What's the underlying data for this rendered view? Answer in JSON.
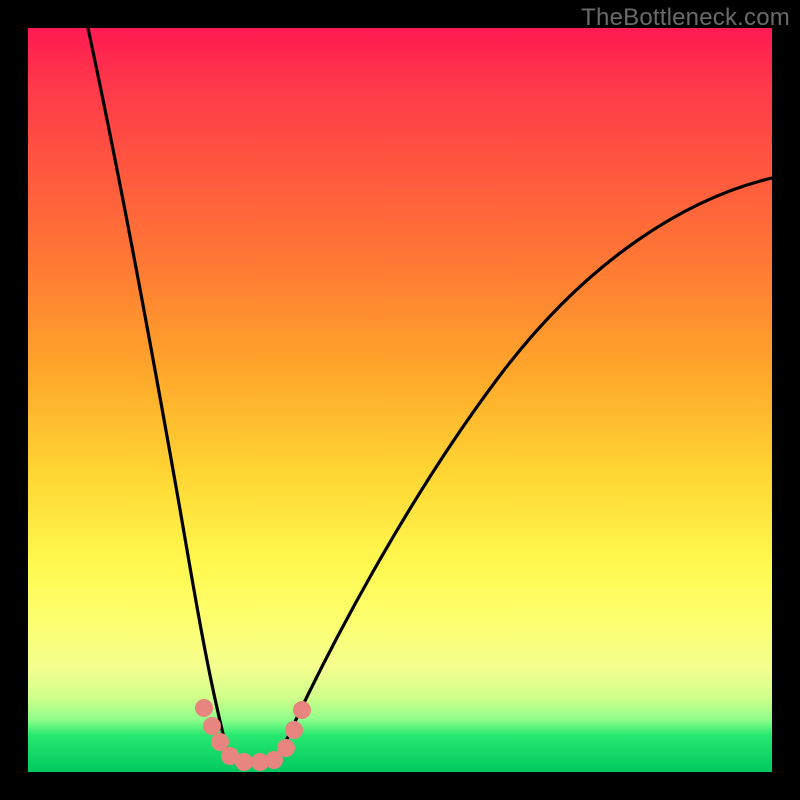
{
  "watermark": "TheBottleneck.com",
  "chart_data": {
    "type": "line",
    "title": "",
    "xlabel": "",
    "ylabel": "",
    "xlim": [
      0,
      100
    ],
    "ylim": [
      0,
      100
    ],
    "series": [
      {
        "name": "left-curve",
        "x": [
          8,
          10,
          12,
          14,
          16,
          18,
          20,
          22,
          24,
          25.5,
          27
        ],
        "y": [
          100,
          82,
          65,
          50,
          37,
          26,
          17,
          10,
          5,
          2,
          0
        ]
      },
      {
        "name": "right-curve",
        "x": [
          34,
          36,
          39,
          43,
          48,
          55,
          63,
          72,
          82,
          92,
          100
        ],
        "y": [
          0,
          4,
          11,
          21,
          33,
          45,
          56,
          65,
          72,
          77,
          80
        ]
      },
      {
        "name": "floor",
        "x": [
          27,
          34
        ],
        "y": [
          0,
          0
        ]
      }
    ],
    "markers": {
      "name": "highlight-points",
      "color": "#e8857f",
      "points": [
        {
          "x": 23.5,
          "y": 7.5
        },
        {
          "x": 24.5,
          "y": 5.0
        },
        {
          "x": 25.5,
          "y": 2.5
        },
        {
          "x": 27.0,
          "y": 1.0
        },
        {
          "x": 29.0,
          "y": 0.6
        },
        {
          "x": 31.0,
          "y": 0.6
        },
        {
          "x": 33.0,
          "y": 0.8
        },
        {
          "x": 34.5,
          "y": 2.5
        },
        {
          "x": 35.7,
          "y": 5.2
        },
        {
          "x": 36.8,
          "y": 8.0
        }
      ]
    }
  }
}
